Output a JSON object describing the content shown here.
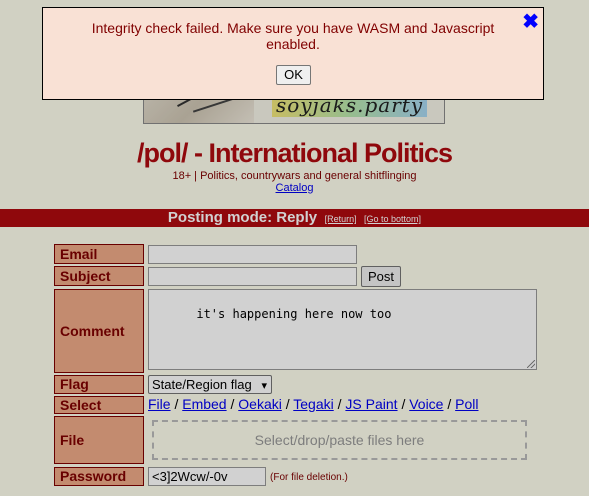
{
  "banner": {
    "text": "soyjaks.party"
  },
  "board": {
    "title": "/pol/ - International Politics",
    "subtitle": "18+ | Politics, countrywars and general shitflinging",
    "catalog_label": "Catalog"
  },
  "mode_bar": {
    "text": "Posting mode: Reply",
    "return_label": "[Return]",
    "bottom_label": "[Go to bottom]"
  },
  "form": {
    "email_label": "Email",
    "email_value": "",
    "subject_label": "Subject",
    "subject_value": "",
    "post_button": "Post",
    "comment_label": "Comment",
    "comment_value": "it's happening here now too",
    "flag_label": "Flag",
    "flag_value": "State/Region flag",
    "select_label": "Select",
    "select_links": [
      "File",
      "Embed",
      "Oekaki",
      "Tegaki",
      "JS Paint",
      "Voice",
      "Poll"
    ],
    "select_separator": "/",
    "file_label": "File",
    "dropzone_text": "Select/drop/paste files here",
    "password_label": "Password",
    "password_value": "<3]2Wcw/-0v",
    "password_note": "(For file deletion.)"
  },
  "dialog": {
    "message": "Integrity check failed. Make sure you have WASM and Javascript enabled.",
    "close_icon": "✖",
    "ok_label": "OK"
  },
  "colors": {
    "page_bg": "#ffffee",
    "accent": "#af0a0f",
    "label_bg": "#eeaa88",
    "dialog_bg": "#f9e1d5",
    "link": "#0000ee"
  }
}
